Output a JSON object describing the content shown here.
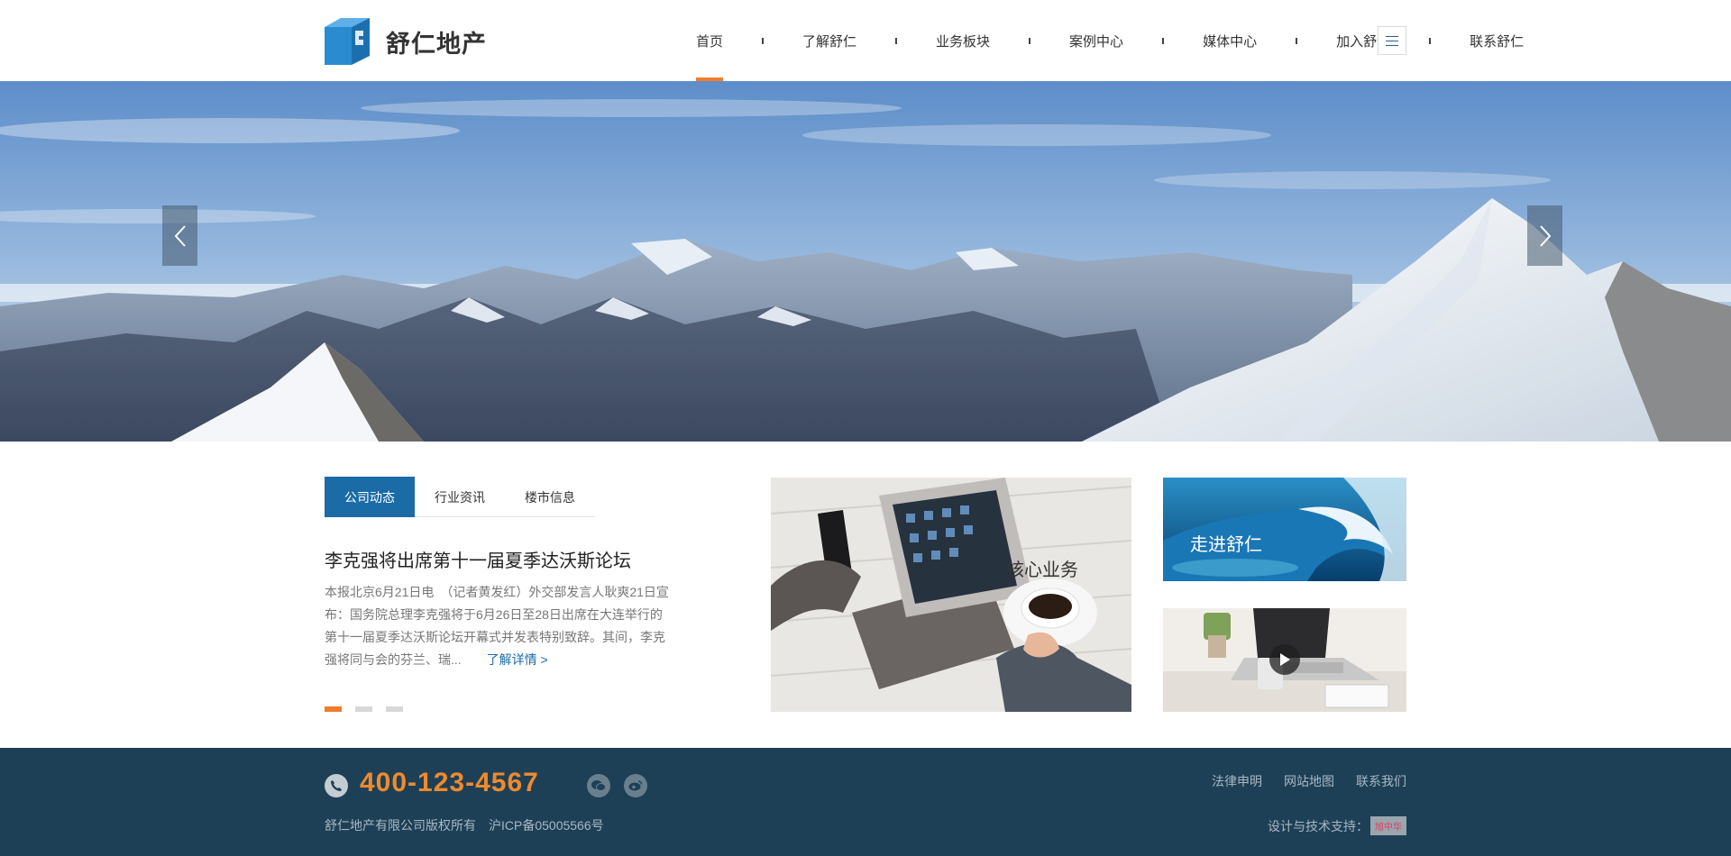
{
  "brand": {
    "name": "舒仁地产",
    "accent_color": "#f07d2b",
    "primary_color": "#1b6ba7"
  },
  "nav": {
    "items": [
      {
        "label": "首页",
        "active": true
      },
      {
        "label": "了解舒仁"
      },
      {
        "label": "业务板块"
      },
      {
        "label": "案例中心"
      },
      {
        "label": "媒体中心"
      },
      {
        "label": "加入舒仁"
      },
      {
        "label": "联系舒仁"
      }
    ],
    "menu_icon": "hamburger-menu-icon"
  },
  "banner": {
    "prev_icon": "chevron-left-icon",
    "next_icon": "chevron-right-icon"
  },
  "news": {
    "tabs": [
      {
        "label": "公司动态",
        "active": true
      },
      {
        "label": "行业资讯"
      },
      {
        "label": "楼市信息"
      }
    ],
    "title": "李克强将出席第十一届夏季达沃斯论坛",
    "summary": "本报北京6月21日电　（记者黄发红）外交部发言人耿爽21日宣布：国务院总理李克强将于6月26日至28日出席在大连举行的第十一届夏季达沃斯论坛开幕式并发表特别致辞。其间，李克强将同与会的芬兰、瑞...",
    "more_label": "了解详情 >",
    "pagination": {
      "total": 3,
      "active": 1
    }
  },
  "cards": {
    "core_business": "核心业务",
    "about": "走进舒仁",
    "video_icon": "play-icon"
  },
  "footer": {
    "hotline": "400-123-4567",
    "hotline_icon": "phone-icon",
    "social_icons": [
      "wechat-icon",
      "weibo-icon"
    ],
    "links": [
      "法律申明",
      "网站地图",
      "联系我们"
    ],
    "copyright": "舒仁地产有限公司版权所有",
    "icp": "沪ICP备05005566号",
    "support_label": "设计与技术支持：",
    "support_badge": "旭中华",
    "background": "#1d4057"
  }
}
